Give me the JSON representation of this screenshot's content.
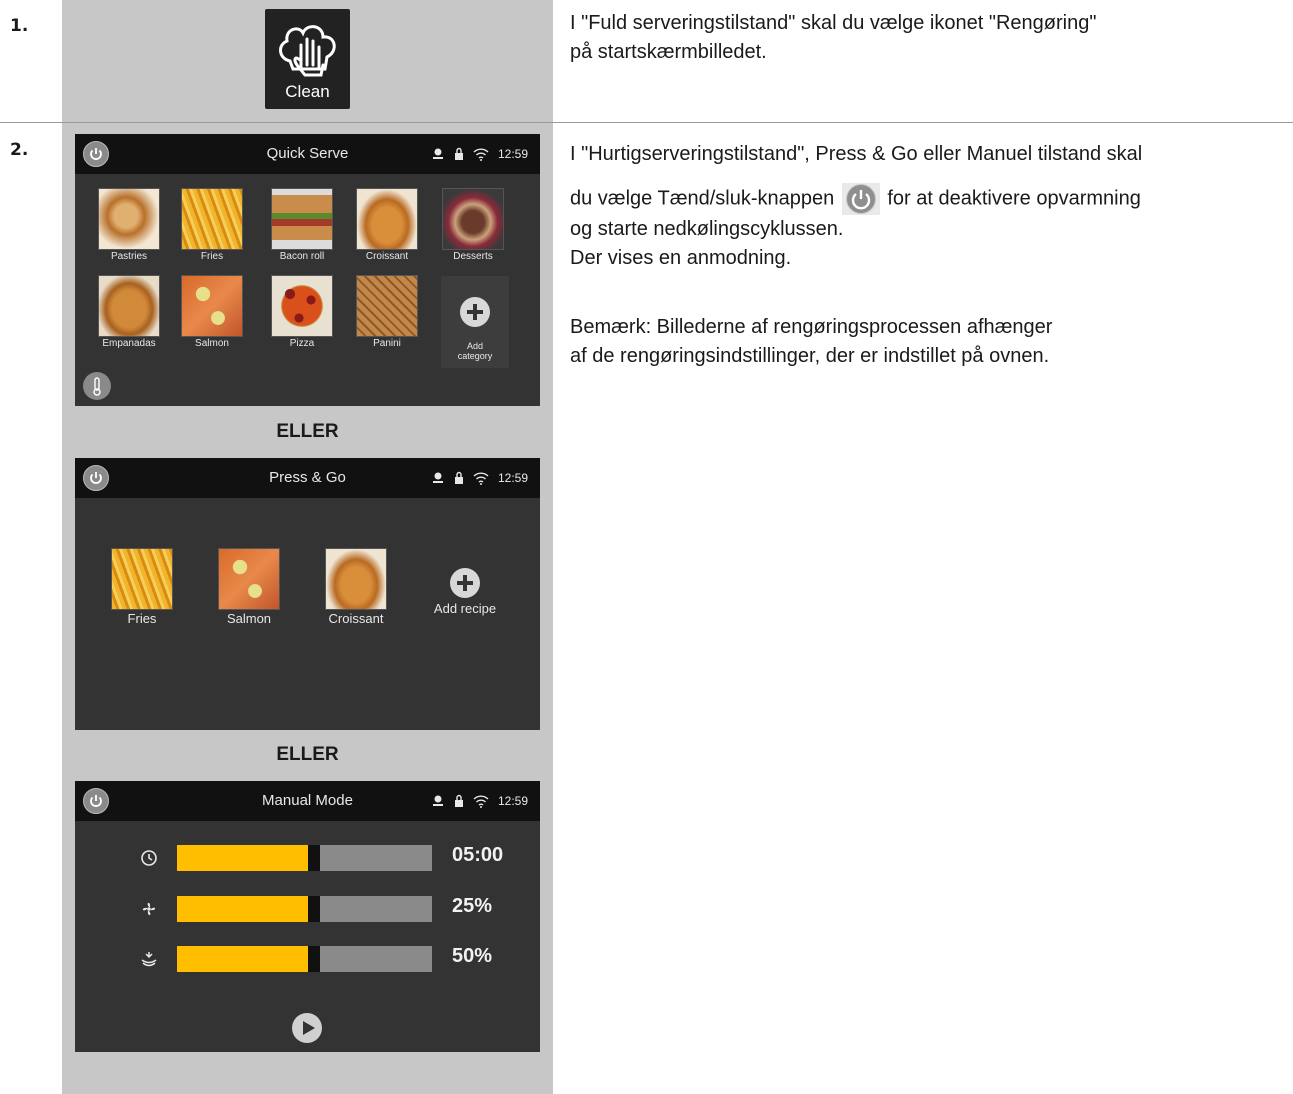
{
  "steps": [
    {
      "number": "1.",
      "text_lines": [
        "I \"Fuld serveringstilstand\" skal du vælge ikonet \"Rengøring\"",
        "på startskærmbilledet."
      ]
    },
    {
      "number": "2.",
      "line1": "I \"Hurtigserveringstilstand\", Press & Go eller Manuel tilstand skal",
      "line2_before": "du vælge Tænd/sluk-knappen",
      "line2_after": "for at deaktivere opvarmning",
      "line3": "og starte nedkølingscyklussen.",
      "line4": "Der vises en anmodning.",
      "note_lines": [
        "Bemærk: Billederne af rengøringsprocessen afhænger",
        "af de rengøringsindstillinger, der er indstillet på ovnen."
      ]
    }
  ],
  "clean_icon": {
    "label": "Clean",
    "icon": "hand-in-chef-hat-icon"
  },
  "separator": "ELLER",
  "status_bar": {
    "time": "12:59"
  },
  "quick_serve": {
    "title": "Quick Serve",
    "items": [
      "Pastries",
      "Fries",
      "Bacon roll",
      "Croissant",
      "Desserts",
      "Empanadas",
      "Salmon",
      "Pizza",
      "Panini"
    ],
    "add_label_1": "Add",
    "add_label_2": "category"
  },
  "press_go": {
    "title": "Press & Go",
    "items": [
      "Fries",
      "Salmon",
      "Croissant"
    ],
    "add_label": "Add recipe"
  },
  "manual_mode": {
    "title": "Manual Mode",
    "rows": [
      {
        "icon": "clock-icon",
        "value": "05:00",
        "level": 0.52
      },
      {
        "icon": "fan-icon",
        "value": "25%",
        "level": 0.52
      },
      {
        "icon": "steam-icon",
        "value": "50%",
        "level": 0.52
      }
    ]
  },
  "colors": {
    "accent": "#ffbf00",
    "screen_bg": "#333333",
    "topbar": "#111111",
    "column_gray": "#c7c7c7"
  }
}
